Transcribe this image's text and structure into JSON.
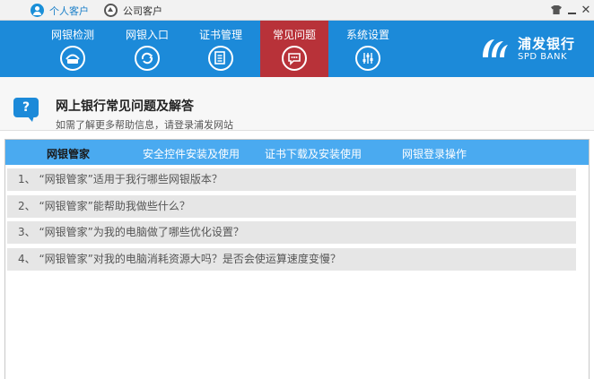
{
  "accounts": {
    "personal": "个人客户",
    "company": "公司客户"
  },
  "window_controls": {
    "skin_icon": "shirt-icon",
    "minimize_icon": "minimize-icon",
    "close_label": "✕"
  },
  "nav": {
    "items": [
      {
        "label": "网银检测",
        "icon": "monitor-icon"
      },
      {
        "label": "网银入口",
        "icon": "refresh-icon"
      },
      {
        "label": "证书管理",
        "icon": "document-icon"
      },
      {
        "label": "常见问题",
        "icon": "chat-icon",
        "active": true
      },
      {
        "label": "系统设置",
        "icon": "sliders-icon"
      }
    ],
    "active_color": "#b83239",
    "bar_color": "#1c8ad9"
  },
  "brand": {
    "name_cn": "浦发银行",
    "name_en": "SPD BANK"
  },
  "page": {
    "bubble_glyph": "?",
    "title": "网上银行常见问题及解答",
    "subtitle": "如需了解更多帮助信息，请登录浦发网站"
  },
  "tabs": [
    {
      "label": "网银管家",
      "active": true
    },
    {
      "label": "安全控件安装及使用"
    },
    {
      "label": "证书下载及安装使用"
    },
    {
      "label": "网银登录操作"
    }
  ],
  "questions": [
    "1、 “网银管家”适用于我行哪些网银版本？",
    "2、 “网银管家”能帮助我做些什么？",
    "3、 “网银管家”为我的电脑做了哪些优化设置？",
    "4、 “网银管家”对我的电脑消耗资源大吗？是否会使运算速度变慢？"
  ]
}
